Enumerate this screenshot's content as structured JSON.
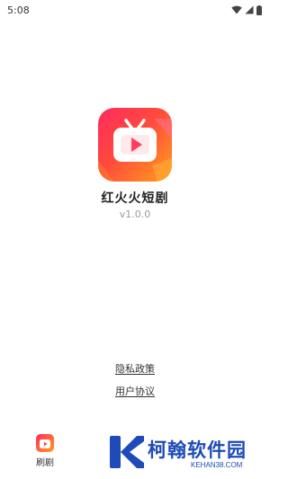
{
  "status_bar": {
    "time": "5:08",
    "icons": [
      "wifi-icon",
      "signal-icon",
      "battery-icon"
    ]
  },
  "app": {
    "name": "红火火短剧",
    "version": "v1.0.0",
    "icon": "tv-play-icon",
    "brand_colors": [
      "#ff2a5f",
      "#ff9f1c"
    ]
  },
  "links": {
    "privacy": "隐私政策",
    "user_agreement": "用户协议"
  },
  "bottom_app": {
    "label": "刷剧",
    "icon": "tv-play-icon"
  },
  "watermark": {
    "cn": "柯翰软件园",
    "en": "KEHAN38.COM",
    "color": "#1e4bb8"
  }
}
